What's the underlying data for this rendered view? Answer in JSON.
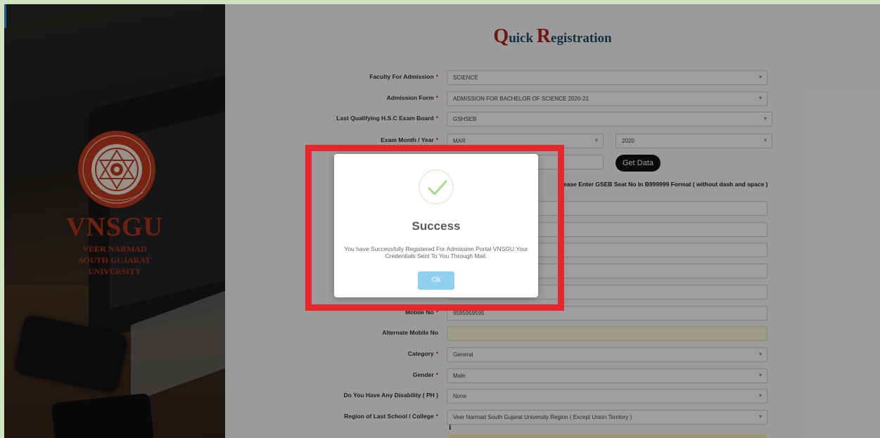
{
  "brand": {
    "name": "VNSGU",
    "full_name_line1": "VEER NARMAD",
    "full_name_line2": "SOUTH GUJARAT",
    "full_name_line3": "UNIVERSITY"
  },
  "page": {
    "title_first_cap": "Q",
    "title_first_rest": "uick ",
    "title_second_cap": "R",
    "title_second_rest": "egistration"
  },
  "form": {
    "faculty": {
      "label": "Faculty For Admission",
      "value": "SCIENCE"
    },
    "admission_form": {
      "label": "Admission Form",
      "value": "ADMISSION FOR BACHELOR OF SCIENCE 2020-21"
    },
    "exam_board": {
      "label": "Last Qualifying H.S.C Exam Board",
      "value": "GSHSEB"
    },
    "exam_month_year": {
      "label": "Exam Month / Year",
      "month": "MAR",
      "year": "2020"
    },
    "get_data_label": "Get Data",
    "seat_hint": "ease Enter GSEB Seat No In B999999 Format ( without dash and space )",
    "mobile": {
      "label": "Mobile No",
      "value": "9595959595"
    },
    "alt_mobile": {
      "label": "Alternate Mobile No",
      "value": ""
    },
    "category": {
      "label": "Category",
      "value": "General"
    },
    "gender": {
      "label": "Gender",
      "value": "Male"
    },
    "disability": {
      "label": "Do You Have Any Disability ( PH )",
      "value": "None"
    },
    "region": {
      "label": "Region of Last School / College",
      "value": "Veer Narmad South Gujarat University Region ( Except Union Territory )"
    },
    "required_mark": "*"
  },
  "modal": {
    "title": "Success",
    "message": "You have Successfully Registered For Admission Portal VNSGU.Your Credentials Sent To You Through Mail.",
    "ok_label": "Ok",
    "icon": "check-icon"
  },
  "colors": {
    "highlight": "#e8262c",
    "brand": "#b3351c",
    "ok": "#8fd0f0",
    "check": "#a5dc86"
  }
}
